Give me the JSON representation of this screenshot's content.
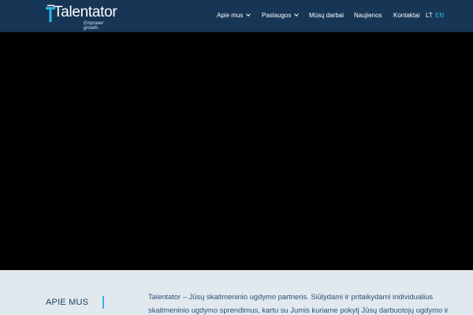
{
  "brand": {
    "name": "Talentator",
    "tagline": "Empower growth.",
    "accent_color": "#2db7e8",
    "header_color": "#173656"
  },
  "nav": {
    "items": [
      {
        "label": "Apie mus",
        "has_dropdown": true
      },
      {
        "label": "Paslaugos",
        "has_dropdown": true
      },
      {
        "label": "Mūsų darbai",
        "has_dropdown": false
      },
      {
        "label": "Naujienos",
        "has_dropdown": false
      },
      {
        "label": "Kontaktai",
        "has_dropdown": false
      }
    ],
    "languages": [
      "LT",
      "EN"
    ],
    "active_language": "EN"
  },
  "about": {
    "title": "APIE MUS",
    "text_line1": "Talentator – Jūsų skaitmeninio ugdymo partneris. Siūlydami ir pritaikydami individualius",
    "text_line2": "skaitmeninio ugdymo sprendimus, kartu su Jumis kuriame pokytį Jūsų darbuotojų ugdymo ir"
  }
}
